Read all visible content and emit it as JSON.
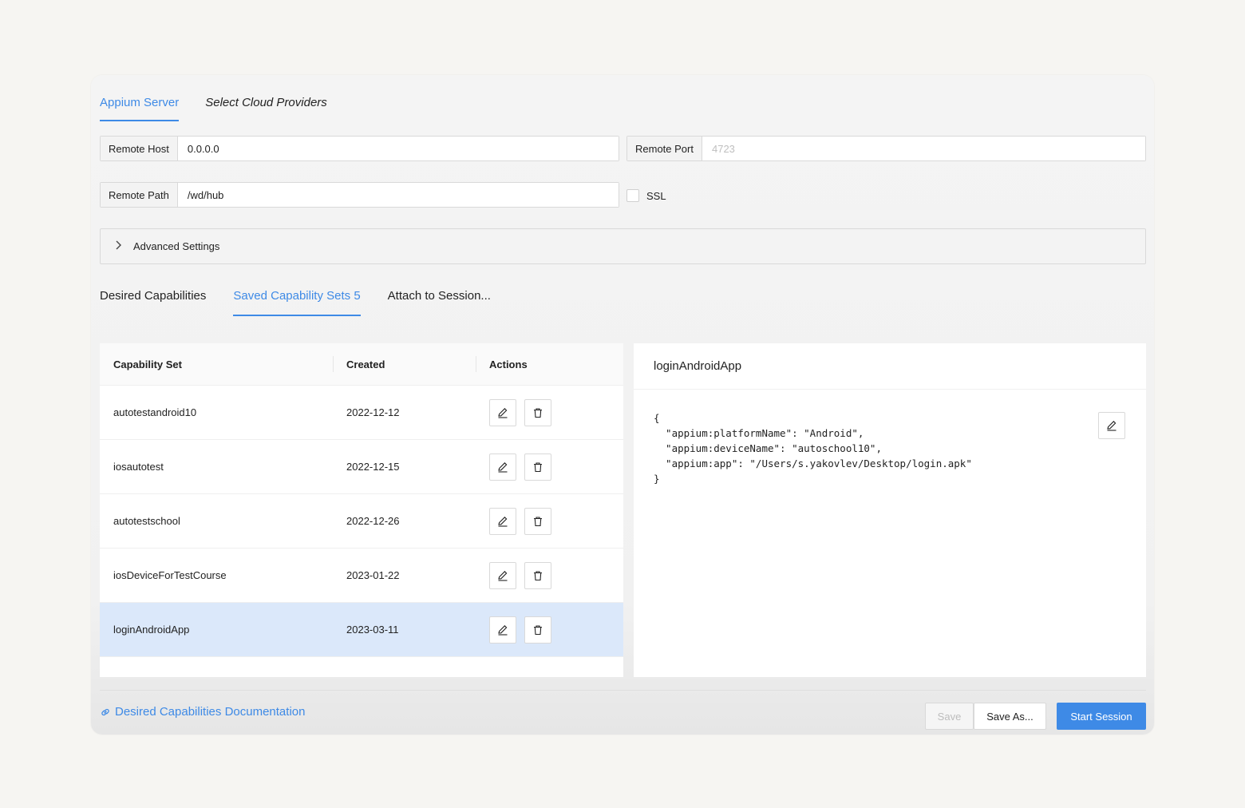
{
  "server_tabs": [
    {
      "label": "Appium Server",
      "active": true
    },
    {
      "label": "Select Cloud Providers",
      "active": false
    }
  ],
  "remote_host": {
    "label": "Remote Host",
    "value": "0.0.0.0"
  },
  "remote_port": {
    "label": "Remote Port",
    "placeholder": "4723",
    "value": ""
  },
  "remote_path": {
    "label": "Remote Path",
    "value": "/wd/hub"
  },
  "ssl": {
    "label": "SSL",
    "checked": false
  },
  "advanced": {
    "label": "Advanced Settings",
    "icon": "chevron-right-icon"
  },
  "caps_tabs": [
    {
      "label": "Desired Capabilities",
      "active": false
    },
    {
      "label": "Saved Capability Sets 5",
      "active": true
    },
    {
      "label": "Attach to Session...",
      "active": false
    }
  ],
  "table": {
    "headers": [
      "Capability Set",
      "Created",
      "Actions"
    ],
    "rows": [
      {
        "name": "autotestandroid10",
        "created": "2022-12-12",
        "selected": false
      },
      {
        "name": "iosautotest",
        "created": "2022-12-15",
        "selected": false
      },
      {
        "name": "autotestschool",
        "created": "2022-12-26",
        "selected": false
      },
      {
        "name": "iosDeviceForTestCourse",
        "created": "2023-01-22",
        "selected": false
      },
      {
        "name": "loginAndroidApp",
        "created": "2023-03-11",
        "selected": true
      }
    ]
  },
  "detail": {
    "title": "loginAndroidApp",
    "json": "{\n  \"appium:platformName\": \"Android\",\n  \"appium:deviceName\": \"autoschool10\",\n  \"appium:app\": \"/Users/s.yakovlev/Desktop/login.apk\"\n}"
  },
  "footer": {
    "doc_link": "Desired Capabilities Documentation",
    "save_label": "Save",
    "save_as_label": "Save As...",
    "start_label": "Start Session"
  },
  "colors": {
    "accent": "#3e8ae6",
    "selected_row": "#dbe8fa"
  }
}
